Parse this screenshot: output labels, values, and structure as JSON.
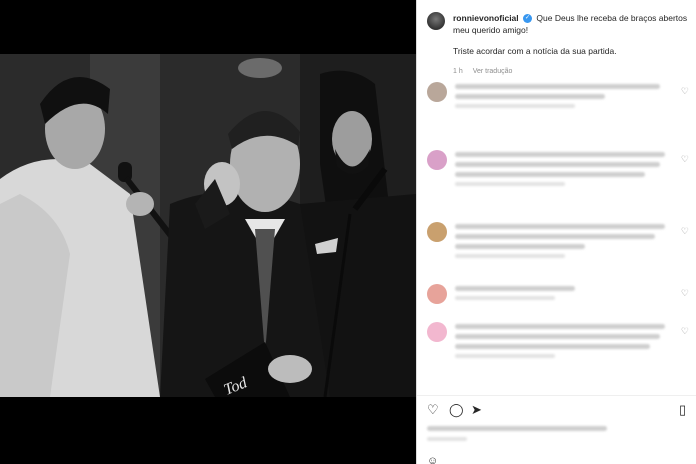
{
  "post": {
    "username": "ronnievonoficial",
    "caption_line1": "Que Deus lhe receba de braços abertos meu querido amigo!",
    "caption_line2": "Triste acordar com a notícia da sua partida.",
    "time_ago": "1 h",
    "translate_label": "Ver tradução",
    "photo_text": "Tod"
  },
  "comments": [
    {
      "avatar_color": "#b9a79a",
      "lines": 2
    },
    {
      "avatar_color": "#d9a0c8",
      "lines": 3
    },
    {
      "avatar_color": "#c9a06e",
      "lines": 3
    },
    {
      "avatar_color": "#e7a39a",
      "lines": 1
    },
    {
      "avatar_color": "#f2b7cf",
      "lines": 3
    }
  ],
  "icons": {
    "heart": "heart-icon",
    "comment": "comment-icon",
    "share": "share-icon",
    "save": "bookmark-icon",
    "emoji": "emoji-icon",
    "verified": "verified-icon"
  }
}
